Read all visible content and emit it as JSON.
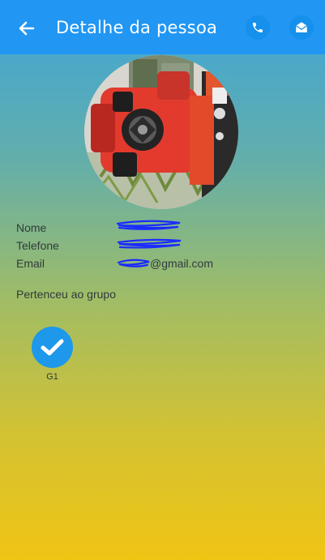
{
  "header": {
    "title": "Detalhe da pessoa",
    "back_icon": "arrow-left-icon",
    "call_icon": "phone-icon",
    "mail_icon": "envelope-icon"
  },
  "profile": {
    "name_label": "Nome",
    "name_value": "",
    "phone_label": "Telefone",
    "phone_value": "",
    "email_label": "Email",
    "email_value": "@gmail.com"
  },
  "groups": {
    "title": "Pertenceu ao grupo",
    "items": [
      {
        "label": "G1",
        "icon": "check-icon"
      }
    ]
  },
  "colors": {
    "appbar": "#2196f3",
    "gradient_top": "#3ea5d9",
    "gradient_bottom": "#f0c514",
    "redaction": "#1a2bff"
  }
}
